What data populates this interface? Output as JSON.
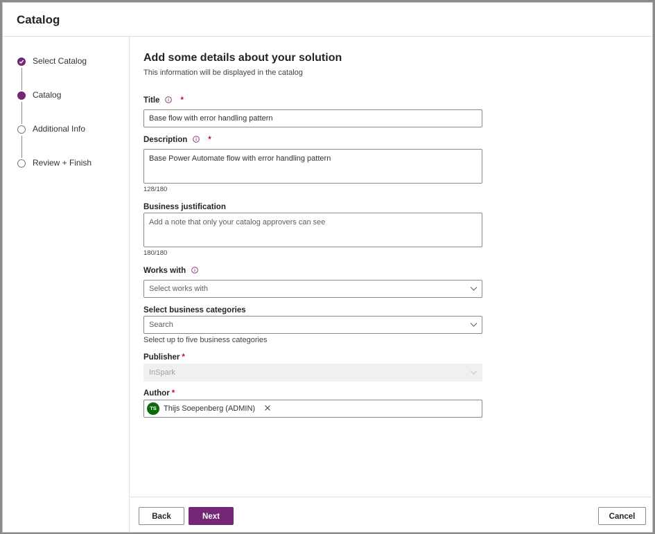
{
  "dialog": {
    "title": "Catalog"
  },
  "steps": [
    {
      "label": "Select Catalog",
      "state": "completed"
    },
    {
      "label": "Catalog",
      "state": "current"
    },
    {
      "label": "Additional Info",
      "state": "pending"
    },
    {
      "label": "Review + Finish",
      "state": "pending"
    }
  ],
  "form": {
    "heading": "Add some details about your solution",
    "subheading": "This information will be displayed in the catalog",
    "title": {
      "label": "Title",
      "required_mark": "*",
      "value": "Base flow with error handling pattern"
    },
    "description": {
      "label": "Description",
      "required_mark": "*",
      "value": "Base Power Automate flow with error handling pattern",
      "counter": "128/180"
    },
    "business_justification": {
      "label": "Business justification",
      "placeholder": "Add a note that only your catalog approvers can see",
      "counter": "180/180"
    },
    "works_with": {
      "label": "Works with",
      "placeholder": "Select works with"
    },
    "business_categories": {
      "label": "Select business categories",
      "placeholder": "Search",
      "hint": "Select up to five business categories"
    },
    "publisher": {
      "label": "Publisher",
      "required_mark": "*",
      "value": "InSpark"
    },
    "author": {
      "label": "Author",
      "required_mark": "*",
      "initials": "TS",
      "name": "Thijs Soepenberg (ADMIN)"
    }
  },
  "footer": {
    "back_label": "Back",
    "next_label": "Next",
    "cancel_label": "Cancel"
  },
  "colors": {
    "accent": "#742774",
    "avatar": "#0b6a0b",
    "required": "#c50f1f"
  }
}
